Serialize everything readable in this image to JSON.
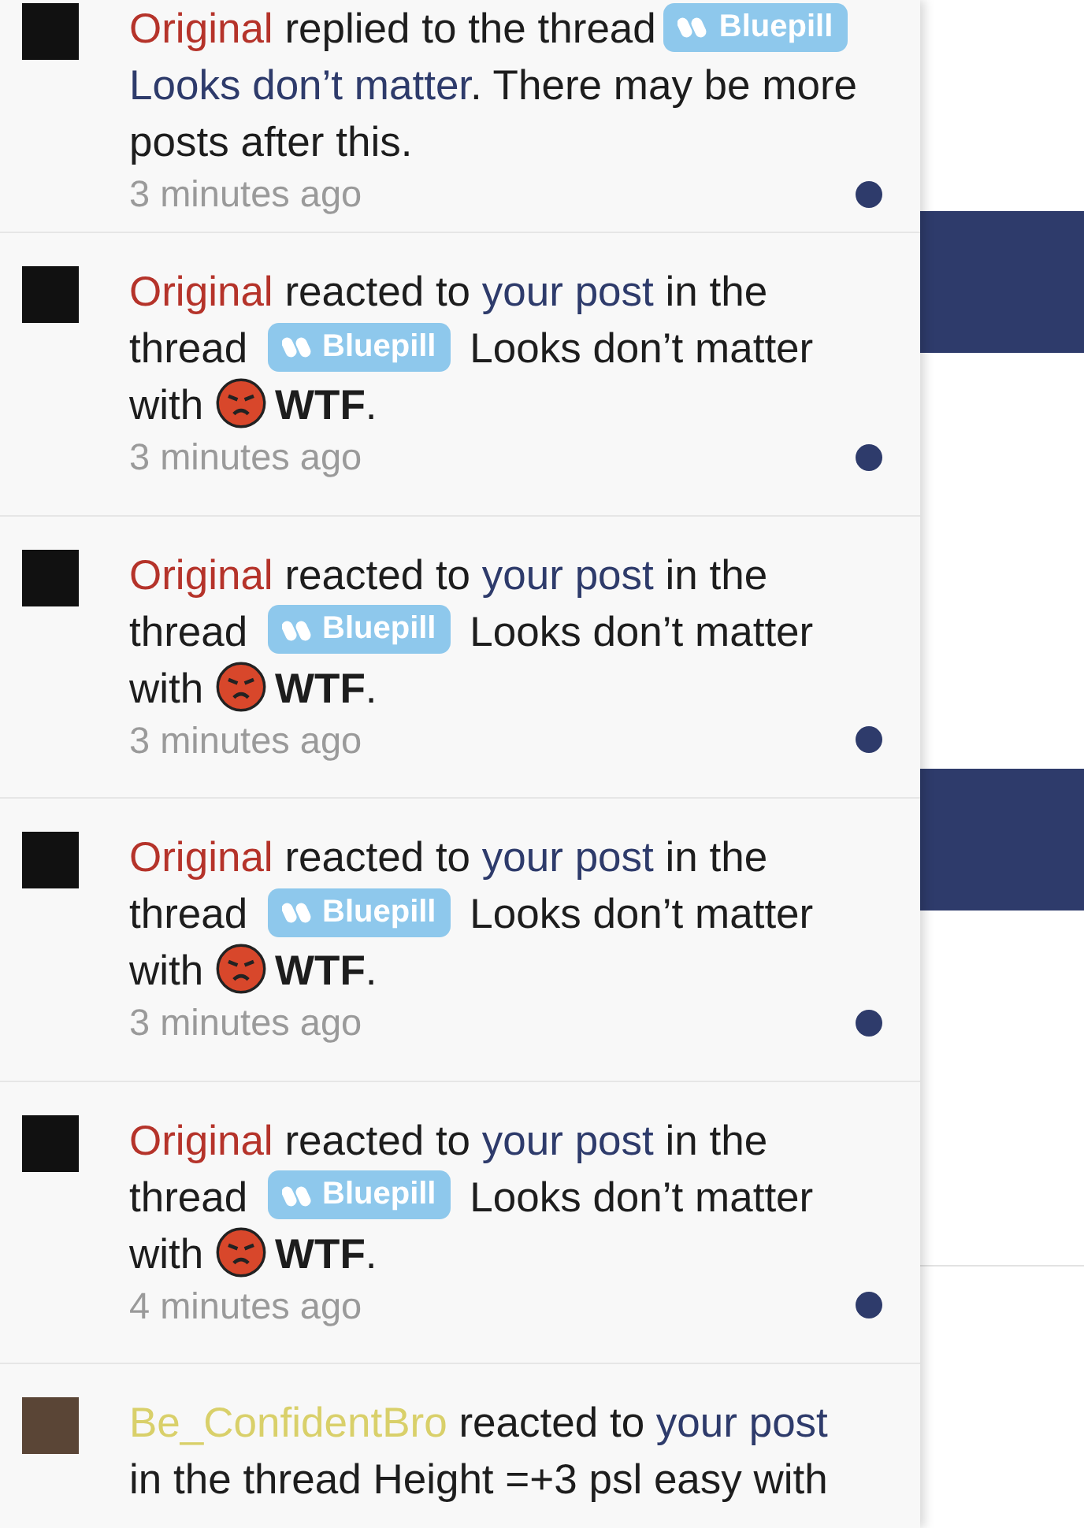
{
  "alerts": [
    {
      "unread": true,
      "time": "3 minutes ago",
      "segments": [
        {
          "kind": "user",
          "text": "Original",
          "color": "#b5332a"
        },
        {
          "kind": "text",
          "text": " replied to the thread"
        },
        {
          "kind": "prefix",
          "text": "Bluepill"
        },
        {
          "kind": "link",
          "text": "Looks don’t matter"
        },
        {
          "kind": "text",
          "text": ". There may be more posts after this."
        }
      ]
    },
    {
      "unread": true,
      "time": "3 minutes ago",
      "segments": [
        {
          "kind": "user",
          "text": "Original",
          "color": "#b5332a"
        },
        {
          "kind": "text",
          "text": " reacted to "
        },
        {
          "kind": "link",
          "text": "your post"
        },
        {
          "kind": "text",
          "text": " in the thread "
        },
        {
          "kind": "prefix",
          "text": "Bluepill"
        },
        {
          "kind": "text",
          "text": " Looks don’t matter with "
        },
        {
          "kind": "reaction",
          "text": "WTF"
        },
        {
          "kind": "text",
          "text": "."
        }
      ]
    },
    {
      "unread": true,
      "time": "3 minutes ago",
      "segments": [
        {
          "kind": "user",
          "text": "Original",
          "color": "#b5332a"
        },
        {
          "kind": "text",
          "text": " reacted to "
        },
        {
          "kind": "link",
          "text": "your post"
        },
        {
          "kind": "text",
          "text": " in the thread "
        },
        {
          "kind": "prefix",
          "text": "Bluepill"
        },
        {
          "kind": "text",
          "text": " Looks don’t matter with "
        },
        {
          "kind": "reaction",
          "text": "WTF"
        },
        {
          "kind": "text",
          "text": "."
        }
      ]
    },
    {
      "unread": true,
      "time": "3 minutes ago",
      "segments": [
        {
          "kind": "user",
          "text": "Original",
          "color": "#b5332a"
        },
        {
          "kind": "text",
          "text": " reacted to "
        },
        {
          "kind": "link",
          "text": "your post"
        },
        {
          "kind": "text",
          "text": " in the thread "
        },
        {
          "kind": "prefix",
          "text": "Bluepill"
        },
        {
          "kind": "text",
          "text": " Looks don’t matter with "
        },
        {
          "kind": "reaction",
          "text": "WTF"
        },
        {
          "kind": "text",
          "text": "."
        }
      ]
    },
    {
      "unread": true,
      "time": "4 minutes ago",
      "segments": [
        {
          "kind": "user",
          "text": "Original",
          "color": "#b5332a"
        },
        {
          "kind": "text",
          "text": " reacted to "
        },
        {
          "kind": "link",
          "text": "your post"
        },
        {
          "kind": "text",
          "text": " in the thread "
        },
        {
          "kind": "prefix",
          "text": "Bluepill"
        },
        {
          "kind": "text",
          "text": " Looks don’t matter with "
        },
        {
          "kind": "reaction",
          "text": "WTF"
        },
        {
          "kind": "text",
          "text": "."
        }
      ]
    },
    {
      "segments": [
        {
          "kind": "user",
          "text": "Be_ConfidentBro",
          "color": "#d9d06a"
        },
        {
          "kind": "text",
          "text": " reacted to "
        },
        {
          "kind": "link",
          "text": "your post"
        },
        {
          "kind": "text",
          "text": " in the thread Height =+3 psl easy with"
        }
      ]
    }
  ]
}
